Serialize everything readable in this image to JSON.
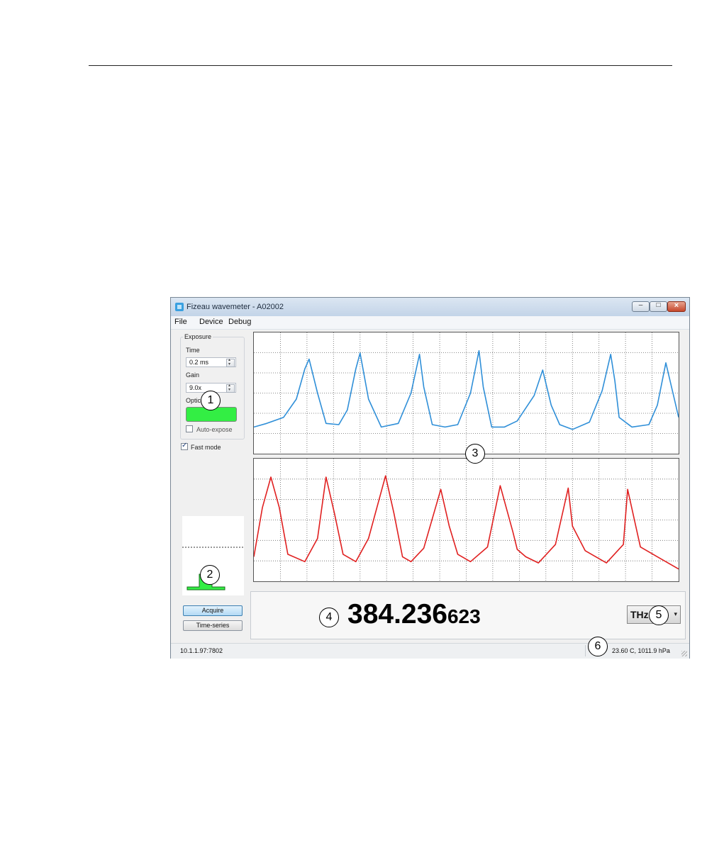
{
  "window": {
    "title": "Fizeau wavemeter - A02002",
    "menu": [
      "File",
      "Device",
      "Debug"
    ]
  },
  "sidebar": {
    "exposure_title": "Exposure",
    "time_label": "Time",
    "time_value": "0.2 ms",
    "gain_label": "Gain",
    "gain_value": "9.0x",
    "optic_label": "Optic",
    "auto_expose_label": "Auto-expose",
    "auto_expose_checked": false,
    "fast_mode_label": "Fast mode",
    "fast_mode_checked": true,
    "acquire_label": "Acquire",
    "time_series_label": "Time-series"
  },
  "readout": {
    "main": "384.236",
    "small": "623",
    "unit": "THz"
  },
  "status": {
    "left": "10.1.1.97:7802",
    "right": "23.60 C, 1011.9 hPa"
  },
  "callouts": [
    "1",
    "2",
    "3",
    "4",
    "5",
    "6"
  ],
  "colors": {
    "upper_trace": "#2f8fd8",
    "lower_trace": "#e02020",
    "optic_level": "#33ee44"
  },
  "chart_data": [
    {
      "type": "line",
      "x": [
        0,
        0.03,
        0.07,
        0.1,
        0.12,
        0.13,
        0.15,
        0.17,
        0.2,
        0.22,
        0.24,
        0.25,
        0.27,
        0.3,
        0.34,
        0.37,
        0.39,
        0.4,
        0.42,
        0.45,
        0.48,
        0.51,
        0.53,
        0.54,
        0.56,
        0.59,
        0.62,
        0.66,
        0.68,
        0.7,
        0.72,
        0.75,
        0.79,
        0.82,
        0.84,
        0.85,
        0.86,
        0.89,
        0.93,
        0.95,
        0.97,
        0.99,
        1.0
      ],
      "values": [
        0.22,
        0.25,
        0.3,
        0.45,
        0.7,
        0.78,
        0.5,
        0.25,
        0.24,
        0.36,
        0.7,
        0.83,
        0.45,
        0.22,
        0.25,
        0.5,
        0.82,
        0.55,
        0.24,
        0.22,
        0.24,
        0.5,
        0.85,
        0.55,
        0.22,
        0.22,
        0.27,
        0.48,
        0.69,
        0.4,
        0.24,
        0.2,
        0.26,
        0.52,
        0.82,
        0.6,
        0.3,
        0.22,
        0.24,
        0.4,
        0.75,
        0.45,
        0.3
      ],
      "ylim": [
        0,
        1
      ],
      "grid": true
    },
    {
      "type": "line",
      "x": [
        0,
        0.02,
        0.04,
        0.06,
        0.08,
        0.12,
        0.15,
        0.17,
        0.19,
        0.21,
        0.24,
        0.27,
        0.31,
        0.33,
        0.35,
        0.37,
        0.4,
        0.44,
        0.46,
        0.48,
        0.51,
        0.55,
        0.58,
        0.61,
        0.62,
        0.64,
        0.67,
        0.71,
        0.74,
        0.75,
        0.78,
        0.83,
        0.87,
        0.88,
        0.91,
        0.95,
        1.0
      ],
      "values": [
        0.2,
        0.6,
        0.85,
        0.6,
        0.22,
        0.16,
        0.35,
        0.85,
        0.55,
        0.22,
        0.16,
        0.35,
        0.86,
        0.55,
        0.2,
        0.16,
        0.27,
        0.75,
        0.45,
        0.22,
        0.16,
        0.28,
        0.78,
        0.4,
        0.26,
        0.2,
        0.15,
        0.3,
        0.76,
        0.45,
        0.25,
        0.15,
        0.3,
        0.75,
        0.28,
        0.2,
        0.1
      ],
      "ylim": [
        0,
        1
      ],
      "grid": true
    }
  ]
}
